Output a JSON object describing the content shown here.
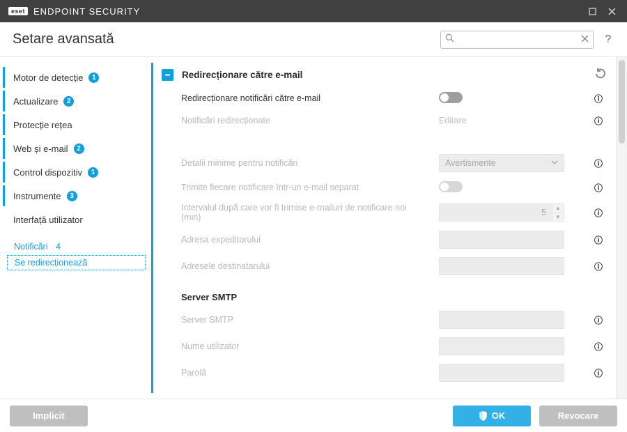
{
  "titlebar": {
    "brand_tag": "eset",
    "product": "ENDPOINT SECURITY"
  },
  "header": {
    "title": "Setare avansată"
  },
  "search": {
    "placeholder": ""
  },
  "sidebar": {
    "items": [
      {
        "label": "Motor de detecție",
        "badge": "1",
        "bar": true
      },
      {
        "label": "Actualizare",
        "badge": "2",
        "bar": true
      },
      {
        "label": "Protecție rețea",
        "bar": true
      },
      {
        "label": "Web și e-mail",
        "badge": "2",
        "bar": true
      },
      {
        "label": "Control dispozitiv",
        "badge": "1",
        "bar": true
      },
      {
        "label": "Instrumente",
        "badge": "3",
        "bar": true
      },
      {
        "label": "Interfață utilizator",
        "bar": false
      }
    ],
    "sub": [
      {
        "label": "Notificări",
        "badge": "4"
      },
      {
        "label": "Se redirecționează",
        "active": true
      }
    ]
  },
  "section": {
    "title": "Redirecționare către e-mail",
    "rows": {
      "r1": {
        "label": "Redirecționare notificări către e-mail"
      },
      "r2": {
        "label": "Notificări redirecționate",
        "value": "Editare"
      },
      "r3": {
        "label": "Detalii minime pentru notificări",
        "value": "Avertismente"
      },
      "r4": {
        "label": "Trimite fiecare notificare într-un e-mail separat"
      },
      "r5": {
        "label": "Intervalul după care vor fi trimise e-mailuri de notificare noi (min)",
        "value": "5"
      },
      "r6": {
        "label": "Adresa expeditorului"
      },
      "r7": {
        "label": "Adresele destinatarului"
      }
    },
    "smtp": {
      "heading": "Server SMTP",
      "r1": {
        "label": "Server SMTP"
      },
      "r2": {
        "label": "Nume utilizator"
      },
      "r3": {
        "label": "Parolă"
      }
    }
  },
  "footer": {
    "default": "Implicit",
    "ok": "OK",
    "cancel": "Revocare"
  }
}
